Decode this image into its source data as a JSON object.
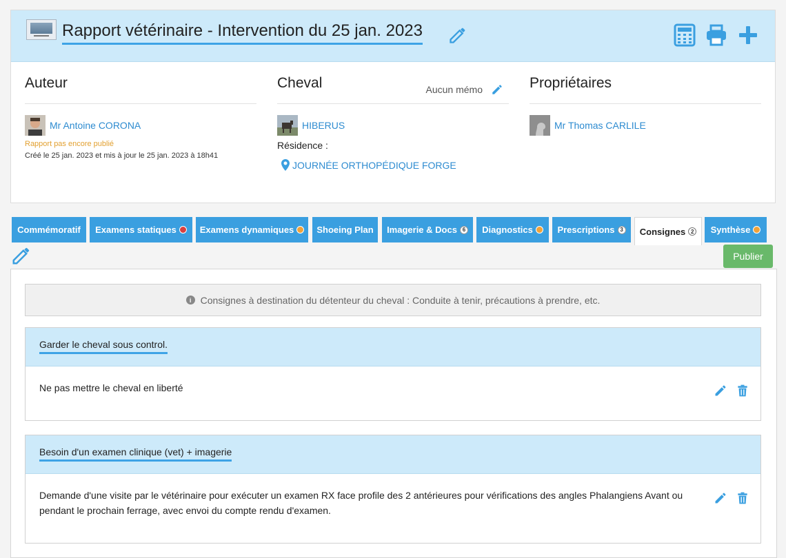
{
  "header": {
    "title": "Rapport vétérinaire - Intervention du 25 jan. 2023"
  },
  "author": {
    "heading": "Auteur",
    "name": "Mr Antoine CORONA",
    "status": "Rapport pas encore publié",
    "dates": "Créé le 25 jan. 2023 et mis à jour le 25 jan. 2023 à 18h41"
  },
  "horse": {
    "heading": "Cheval",
    "memo": "Aucun mémo",
    "name": "HIBERUS",
    "residence_label": "Résidence :",
    "residence": "JOURNÉE ORTHOPÉDIQUE FORGE"
  },
  "owners": {
    "heading": "Propriétaires",
    "name": "Mr Thomas CARLILE"
  },
  "tabs": [
    {
      "label": "Commémoratif",
      "indicator": "none"
    },
    {
      "label": "Examens statiques",
      "indicator": "dot",
      "color": "#d94040"
    },
    {
      "label": "Examens dynamiques",
      "indicator": "dot",
      "color": "#f0a23a"
    },
    {
      "label": "Shoeing Plan",
      "indicator": "none"
    },
    {
      "label": "Imagerie & Docs",
      "indicator": "badge",
      "count": "6"
    },
    {
      "label": "Diagnostics",
      "indicator": "dot",
      "color": "#f0a23a"
    },
    {
      "label": "Prescriptions",
      "indicator": "badge",
      "count": "3"
    },
    {
      "label": "Consignes",
      "indicator": "badge",
      "count": "2",
      "active": true
    },
    {
      "label": "Synthèse",
      "indicator": "dot",
      "color": "#f0a23a"
    }
  ],
  "publish_label": "Publier",
  "info_text": "Consignes à destination du détenteur du cheval : Conduite à tenir, précautions à prendre, etc.",
  "consignes": [
    {
      "title": "Garder le cheval sous control.",
      "body": "Ne pas mettre le cheval en liberté"
    },
    {
      "title": "Besoin d'un examen clinique (vet) + imagerie",
      "body": "Demande d'une visite par le vétérinaire pour exécuter un examen RX face profile des 2 antérieures pour vérifications des angles Phalangiens Avant ou pendant le prochain ferrage, avec envoi du compte rendu d'examen."
    }
  ],
  "colors": {
    "accent": "#3ea3e6",
    "tab_bg": "#3a9fe0",
    "header_bg": "#cdeafa",
    "publish": "#69b96a"
  }
}
